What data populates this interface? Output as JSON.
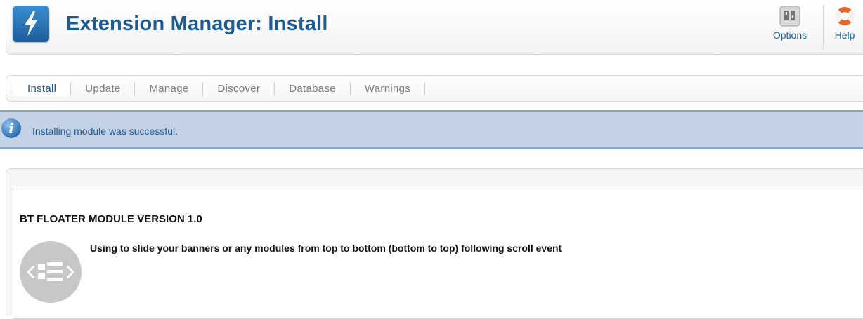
{
  "header": {
    "title": "Extension Manager: Install",
    "app_icon": "lightning-icon",
    "buttons": {
      "options_label": "Options",
      "options_icon": "options-icon",
      "help_label": "Help",
      "help_icon": "lifebuoy-icon"
    }
  },
  "submenu": {
    "tabs": [
      {
        "label": "Install",
        "active": true
      },
      {
        "label": "Update",
        "active": false
      },
      {
        "label": "Manage",
        "active": false
      },
      {
        "label": "Discover",
        "active": false
      },
      {
        "label": "Database",
        "active": false
      },
      {
        "label": "Warnings",
        "active": false
      }
    ]
  },
  "message": {
    "icon": "info-icon",
    "text": "Installing module was successful."
  },
  "module": {
    "title": "BT FLOATER MODULE VERSION 1.0",
    "description": "Using to slide your banners or any modules from top to bottom (bottom to top) following scroll event",
    "logo_icon": "module-logo-icon"
  },
  "colors": {
    "title_blue": "#1c5a92",
    "message_bg": "#c3d2e5",
    "message_border": "#84a7cb",
    "help_orange": "#e8662c"
  }
}
